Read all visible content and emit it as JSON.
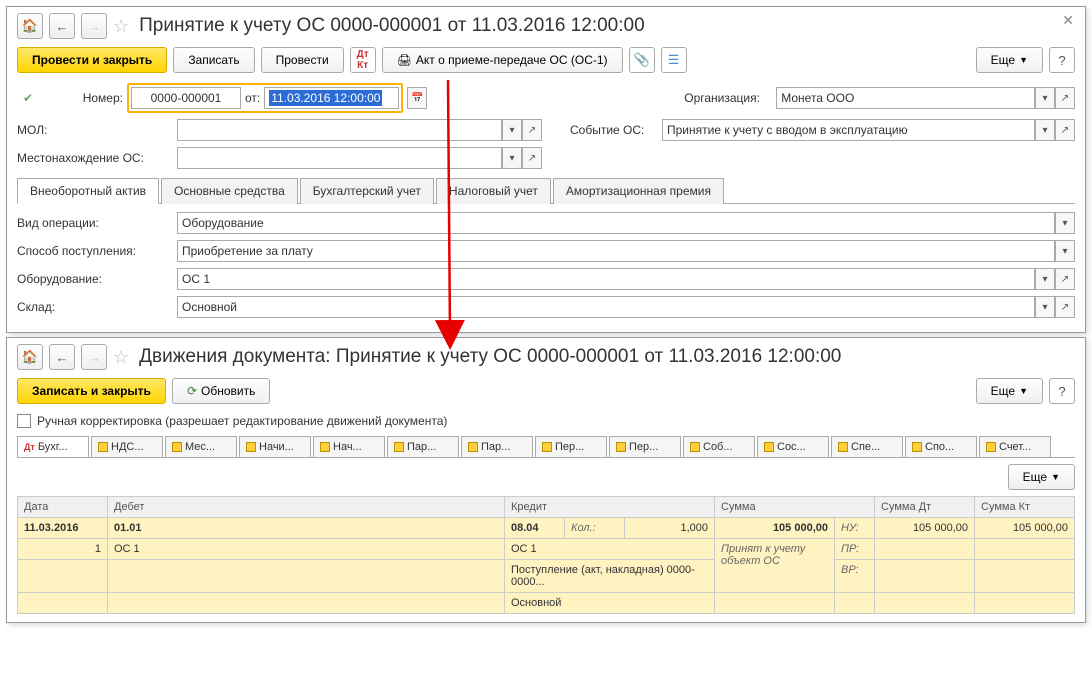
{
  "top": {
    "title": "Принятие к учету ОС 0000-000001 от 11.03.2016 12:00:00",
    "btn_post_close": "Провести и закрыть",
    "btn_write": "Записать",
    "btn_post": "Провести",
    "btn_act": "Акт о приеме-передаче ОС (ОС-1)",
    "btn_more": "Еще",
    "btn_help": "?",
    "number_label": "Номер:",
    "number_value": "0000-000001",
    "from_label": "от:",
    "date_value": "11.03.2016 12:00:00",
    "org_label": "Организация:",
    "org_value": "Монета ООО",
    "mol_label": "МОЛ:",
    "event_label": "Событие ОС:",
    "event_value": "Принятие к учету с вводом в эксплуатацию",
    "loc_label": "Местонахождение ОС:",
    "tabs": [
      "Внеоборотный актив",
      "Основные средства",
      "Бухгалтерский учет",
      "Налоговый учет",
      "Амортизационная премия"
    ],
    "op_type_label": "Вид операции:",
    "op_type_value": "Оборудование",
    "receipt_label": "Способ поступления:",
    "receipt_value": "Приобретение за плату",
    "equip_label": "Оборудование:",
    "equip_value": "ОС 1",
    "warehouse_label": "Склад:",
    "warehouse_value": "Основной"
  },
  "bottom": {
    "title": "Движения документа: Принятие к учету ОС 0000-000001 от 11.03.2016 12:00:00",
    "btn_write_close": "Записать и закрыть",
    "btn_refresh": "Обновить",
    "btn_more": "Еще",
    "btn_help": "?",
    "manual_label": "Ручная корректировка (разрешает редактирование движений документа)",
    "tabs": [
      "Бухг...",
      "НДС...",
      "Мес...",
      "Начи...",
      "Нач...",
      "Пар...",
      "Пар...",
      "Пер...",
      "Пер...",
      "Соб...",
      "Сос...",
      "Спе...",
      "Спо...",
      "Счет..."
    ],
    "headers": {
      "date": "Дата",
      "debit": "Дебет",
      "credit": "Кредит",
      "sum": "Сумма",
      "sum_dt": "Сумма Дт",
      "sum_kt": "Сумма Кт"
    },
    "row1": {
      "date": "11.03.2016",
      "debit_acc": "01.01",
      "credit_acc": "08.04",
      "qty_label": "Кол.:",
      "qty": "1,000",
      "sum": "105 000,00",
      "nu_label": "НУ:",
      "sum_dt": "105 000,00",
      "sum_kt": "105 000,00"
    },
    "row2": {
      "n": "1",
      "debit_sub": "ОС 1",
      "credit_sub1": "ОС 1",
      "desc": "Принят к учету объект ОС",
      "pr_label": "ПР:"
    },
    "row3": {
      "credit_sub2": "Поступление (акт, накладная) 0000-0000...",
      "vr_label": "ВР:"
    },
    "row4": {
      "credit_sub3": "Основной"
    }
  }
}
